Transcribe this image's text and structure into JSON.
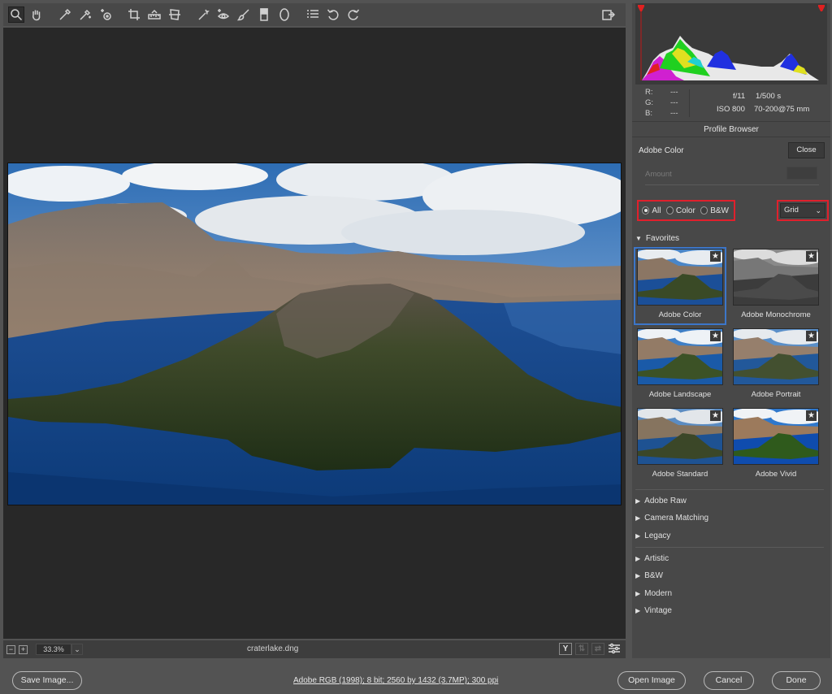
{
  "toolbar": {
    "tools": [
      "zoom-icon",
      "hand-icon",
      "white-balance-icon",
      "color-sampler-icon",
      "targeted-adjustment-icon",
      "crop-icon",
      "straighten-icon",
      "transform-icon",
      "spot-removal-icon",
      "red-eye-icon",
      "adjustment-brush-icon",
      "graduated-filter-icon",
      "radial-filter-icon",
      "preferences-icon",
      "rotate-left-icon",
      "rotate-right-icon"
    ],
    "export_icon": "toggle-fullscreen-icon"
  },
  "statusbar": {
    "zoom_out": "−",
    "zoom_in": "+",
    "zoom": "33.3%",
    "filename": "craterlake.dng",
    "before_after_label": "Y"
  },
  "histogram": {
    "colors": {
      "red": "#e02020",
      "green": "#20d020",
      "blue": "#2030e0",
      "yellow": "#e0e020",
      "magenta": "#d020d0",
      "cyan": "#20d0d0",
      "white": "#e8e8e8"
    }
  },
  "readout": {
    "r_label": "R:",
    "g_label": "G:",
    "b_label": "B:",
    "r": "---",
    "g": "---",
    "b": "---",
    "aperture": "f/11",
    "shutter": "1/500 s",
    "iso": "ISO 800",
    "lens": "70-200@75 mm"
  },
  "profile_browser": {
    "title": "Profile Browser",
    "current_profile": "Adobe Color",
    "close_label": "Close",
    "amount_label": "Amount",
    "filters": [
      {
        "label": "All",
        "checked": true
      },
      {
        "label": "Color",
        "checked": false
      },
      {
        "label": "B&W",
        "checked": false
      }
    ],
    "view_mode": "Grid",
    "favorites_label": "Favorites",
    "thumbnails": [
      {
        "label": "Adobe Color",
        "style": "color",
        "selected": true
      },
      {
        "label": "Adobe Monochrome",
        "style": "mono",
        "selected": false
      },
      {
        "label": "Adobe Landscape",
        "style": "landscape",
        "selected": false
      },
      {
        "label": "Adobe Portrait",
        "style": "portrait",
        "selected": false
      },
      {
        "label": "Adobe Standard",
        "style": "standard",
        "selected": false
      },
      {
        "label": "Adobe Vivid",
        "style": "vivid",
        "selected": false
      }
    ],
    "groups_a": [
      "Adobe Raw",
      "Camera Matching",
      "Legacy"
    ],
    "groups_b": [
      "Artistic",
      "B&W",
      "Modern",
      "Vintage"
    ]
  },
  "bottombar": {
    "save_label": "Save Image...",
    "info": "Adobe RGB (1998); 8 bit; 2560 by 1432 (3.7MP); 300 ppi",
    "open_label": "Open Image",
    "cancel_label": "Cancel",
    "done_label": "Done"
  }
}
